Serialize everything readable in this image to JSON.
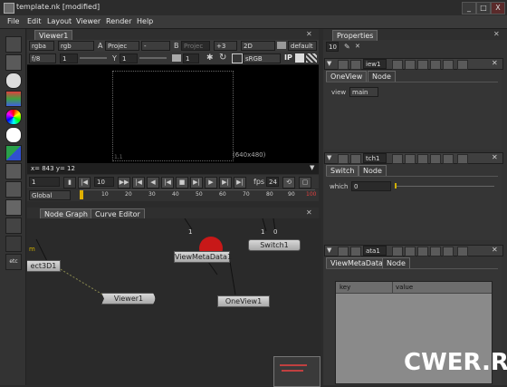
{
  "window": {
    "title": "template.nk [modified]",
    "min": "_",
    "max": "□",
    "close": "X"
  },
  "menu": [
    "File",
    "Edit",
    "Layout",
    "Viewer",
    "Render",
    "Help"
  ],
  "viewer": {
    "tab": "Viewer1",
    "row1": {
      "channels": "rgba",
      "layer": "rgb",
      "a_label": "A",
      "a_input": "Projec",
      "a_op": "-",
      "b_label": "B",
      "b_input": "Projec",
      "gain_val": "+3",
      "mode": "2D",
      "lut": "default"
    },
    "row2": {
      "fstop": "f/8",
      "f_val": "1",
      "y_label": "Y",
      "y_val": "1",
      "frame": "1",
      "space": "sRGB",
      "ip": "IP"
    },
    "format_label": "(640x480)",
    "corner_label": "1,1",
    "status": "x= 843 y= 12",
    "playback": {
      "frame": "1",
      "inc": "10",
      "fps_label": "fps",
      "fps": "24"
    },
    "timeline": {
      "scope": "Global",
      "ticks": [
        "1",
        "10",
        "20",
        "30",
        "40",
        "50",
        "60",
        "70",
        "80",
        "90",
        "100"
      ]
    }
  },
  "graph": {
    "tabs": [
      "Node Graph",
      "Curve Editor"
    ],
    "nodes": {
      "project3d": "ect3D1",
      "viewer": "Viewer1",
      "viewmeta": "ViewMetaData1",
      "switch": "Switch1",
      "oneview": "OneView1"
    },
    "labels": {
      "m": "m",
      "one": "1",
      "one2": "1",
      "zero": "0"
    }
  },
  "properties": {
    "tab": "Properties",
    "max_panels": "10",
    "panels": [
      {
        "name": "iew1",
        "tabs": [
          "OneView",
          "Node"
        ],
        "field_label": "view",
        "field_value": "main"
      },
      {
        "name": "tch1",
        "tabs": [
          "Switch",
          "Node"
        ],
        "field_label": "which",
        "field_value": "0"
      },
      {
        "name": "ata1",
        "tabs": [
          "ViewMetaData",
          "Node"
        ],
        "cols": [
          "key",
          "value"
        ]
      }
    ]
  },
  "watermark": "CWER.RU"
}
